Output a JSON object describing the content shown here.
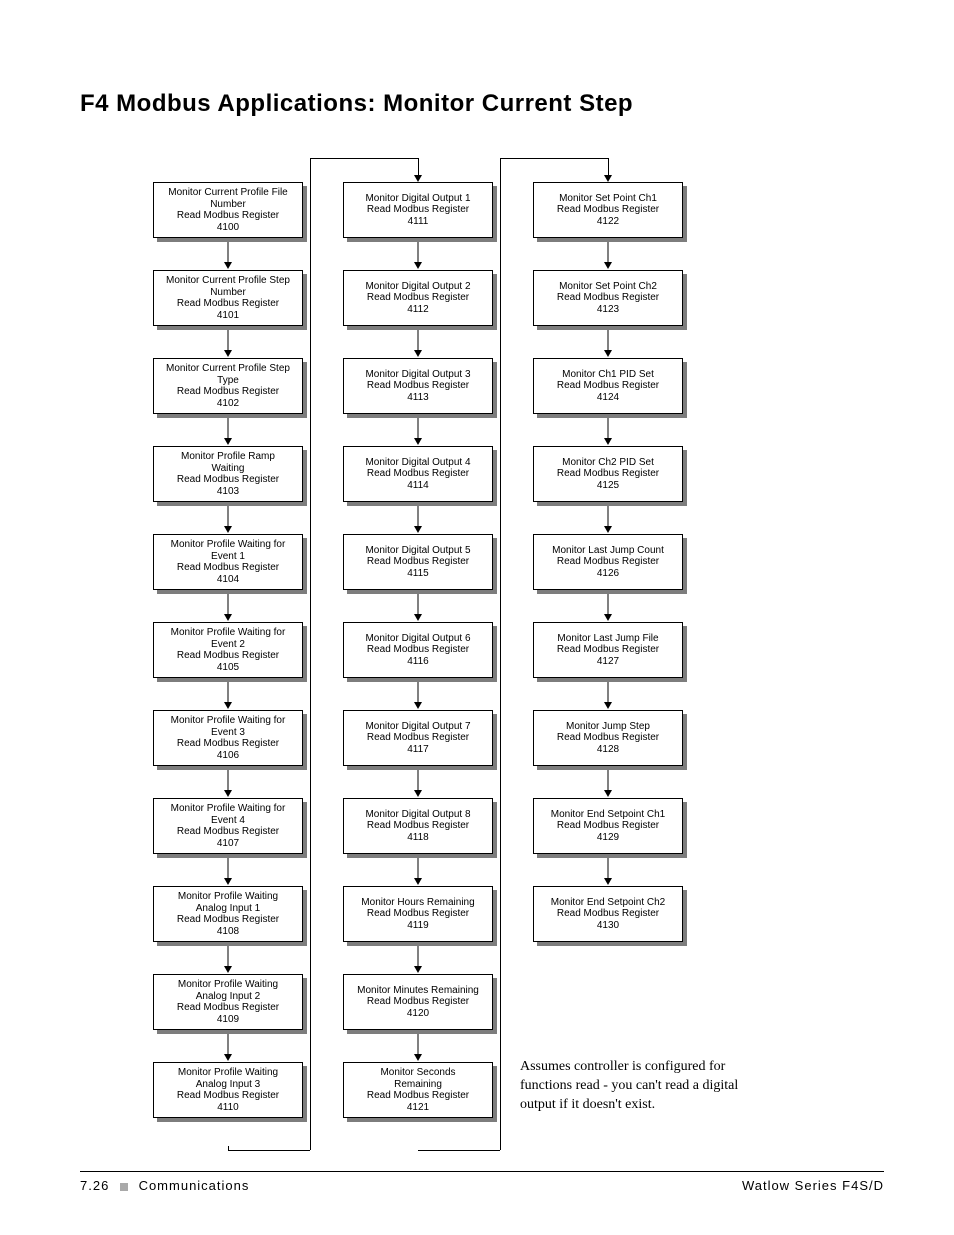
{
  "title": "F4 Modbus Applications:  Monitor Current Step",
  "columns": [
    [
      {
        "l1": "Monitor Current  Profile File",
        "l2": "Number",
        "l3": "Read Modbus Register",
        "l4": "4100"
      },
      {
        "l1": "Monitor Current Profile Step",
        "l2": "Number",
        "l3": "Read Modbus Register",
        "l4": "4101"
      },
      {
        "l1": "Monitor Current Profile Step",
        "l2": "Type",
        "l3": "Read Modbus Register",
        "l4": "4102"
      },
      {
        "l1": "Monitor Profile Ramp",
        "l2": "Waiting",
        "l3": "Read Modbus Register",
        "l4": "4103"
      },
      {
        "l1": "Monitor Profile Waiting for",
        "l2": "Event 1",
        "l3": "Read Modbus Register",
        "l4": "4104"
      },
      {
        "l1": "Monitor Profile Waiting for",
        "l2": "Event 2",
        "l3": "Read Modbus Register",
        "l4": "4105"
      },
      {
        "l1": "Monitor Profile Waiting for",
        "l2": "Event 3",
        "l3": "Read Modbus Register",
        "l4": "4106"
      },
      {
        "l1": "Monitor Profile Waiting for",
        "l2": "Event 4",
        "l3": "Read Modbus Register",
        "l4": "4107"
      },
      {
        "l1": "Monitor Profile Waiting",
        "l2": "Analog Input 1",
        "l3": "Read Modbus Register",
        "l4": "4108"
      },
      {
        "l1": "Monitor Profile Waiting",
        "l2": "Analog Input 2",
        "l3": "Read Modbus Register",
        "l4": "4109"
      },
      {
        "l1": "Monitor Profile Waiting",
        "l2": "Analog Input 3",
        "l3": "Read Modbus Register",
        "l4": "4110"
      }
    ],
    [
      {
        "l1": "Monitor Digital Output 1",
        "l2": "Read Modbus Register",
        "l3": "4111",
        "l4": ""
      },
      {
        "l1": "Monitor Digital Output 2",
        "l2": "Read Modbus Register",
        "l3": "4112",
        "l4": ""
      },
      {
        "l1": "Monitor Digital Output 3",
        "l2": "Read Modbus Register",
        "l3": "4113",
        "l4": ""
      },
      {
        "l1": "Monitor Digital Output 4",
        "l2": "Read Modbus Register",
        "l3": "4114",
        "l4": ""
      },
      {
        "l1": "Monitor Digital Output 5",
        "l2": "Read Modbus Register",
        "l3": "4115",
        "l4": ""
      },
      {
        "l1": "Monitor Digital Output 6",
        "l2": "Read Modbus Register",
        "l3": "4116",
        "l4": ""
      },
      {
        "l1": "Monitor Digital Output 7",
        "l2": "Read Modbus Register",
        "l3": "4117",
        "l4": ""
      },
      {
        "l1": "Monitor Digital Output 8",
        "l2": "Read Modbus Register",
        "l3": "4118",
        "l4": ""
      },
      {
        "l1": "Monitor Hours Remaining",
        "l2": "Read Modbus Register",
        "l3": "4119",
        "l4": ""
      },
      {
        "l1": "Monitor Minutes Remaining",
        "l2": "Read Modbus Register",
        "l3": "4120",
        "l4": ""
      },
      {
        "l1": "Monitor Seconds",
        "l2": "Remaining",
        "l3": "Read Modbus Register",
        "l4": "4121"
      }
    ],
    [
      {
        "l1": "Monitor Set Point Ch1",
        "l2": "Read Modbus Register",
        "l3": "4122",
        "l4": ""
      },
      {
        "l1": "Monitor Set Point Ch2",
        "l2": "Read Modbus Register",
        "l3": "4123",
        "l4": ""
      },
      {
        "l1": "Monitor Ch1 PID Set",
        "l2": "Read Modbus Register",
        "l3": "4124",
        "l4": ""
      },
      {
        "l1": "Monitor Ch2 PID Set",
        "l2": "Read Modbus Register",
        "l3": "4125",
        "l4": ""
      },
      {
        "l1": "Monitor Last Jump Count",
        "l2": "Read Modbus Register",
        "l3": "4126",
        "l4": ""
      },
      {
        "l1": "Monitor Last Jump File",
        "l2": "Read Modbus Register",
        "l3": "4127",
        "l4": ""
      },
      {
        "l1": "Monitor Jump Step",
        "l2": "Read Modbus Register",
        "l3": "4128",
        "l4": ""
      },
      {
        "l1": "Monitor End Setpoint Ch1",
        "l2": "Read Modbus Register",
        "l3": "4129",
        "l4": ""
      },
      {
        "l1": "Monitor End Setpoint Ch2",
        "l2": "Read Modbus Register",
        "l3": "4130",
        "l4": ""
      }
    ]
  ],
  "note": "Assumes controller is configured for functions read - you can't read a digital output if it doesn't exist.",
  "footer": {
    "page": "7.26",
    "section": "Communications",
    "series": "Watlow Series F4S/D"
  }
}
